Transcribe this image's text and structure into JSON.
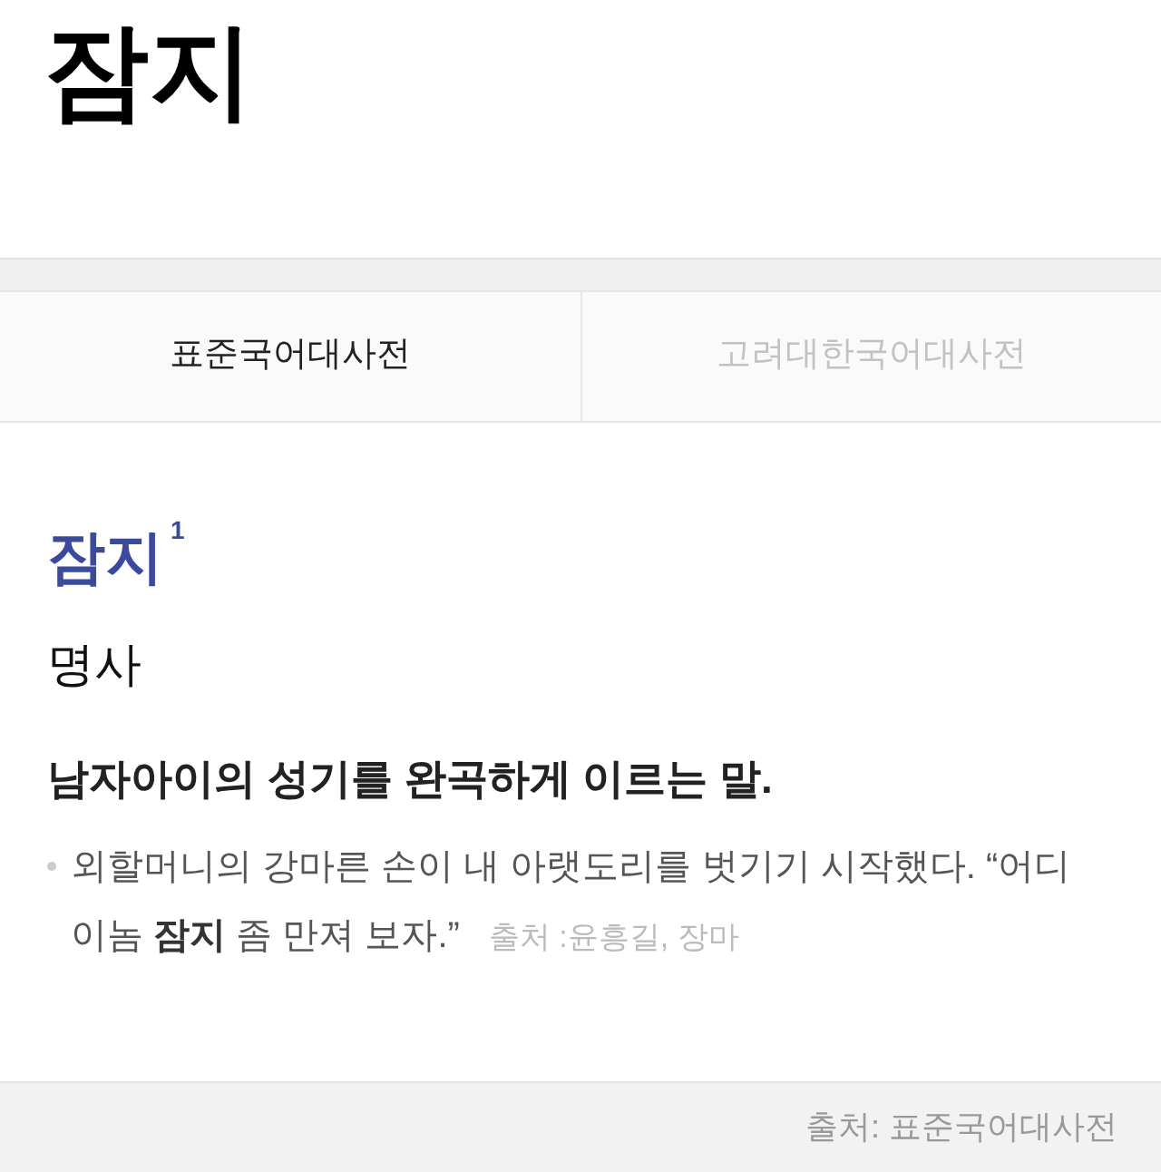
{
  "page_title": "잠지",
  "tabs": [
    {
      "label": "표준국어대사전",
      "selected": true
    },
    {
      "label": "고려대한국어대사전",
      "selected": false
    }
  ],
  "entry": {
    "headword": "잠지$^{1}$",
    "part_of_speech": "명사",
    "definition": "남자아이의 성기를 완곡하게 이르는 말.",
    "examples": [
      {
        "text": "외할머니의 강마른 손이 내 아랫도리를 벗기기 시작했다. “어디 이놈 **잠지** 좀 만져 보자.”",
        "source": "출처 :윤흥길, 장마"
      }
    ]
  },
  "footer": {
    "source": "출처: 표준국어대사전"
  }
}
